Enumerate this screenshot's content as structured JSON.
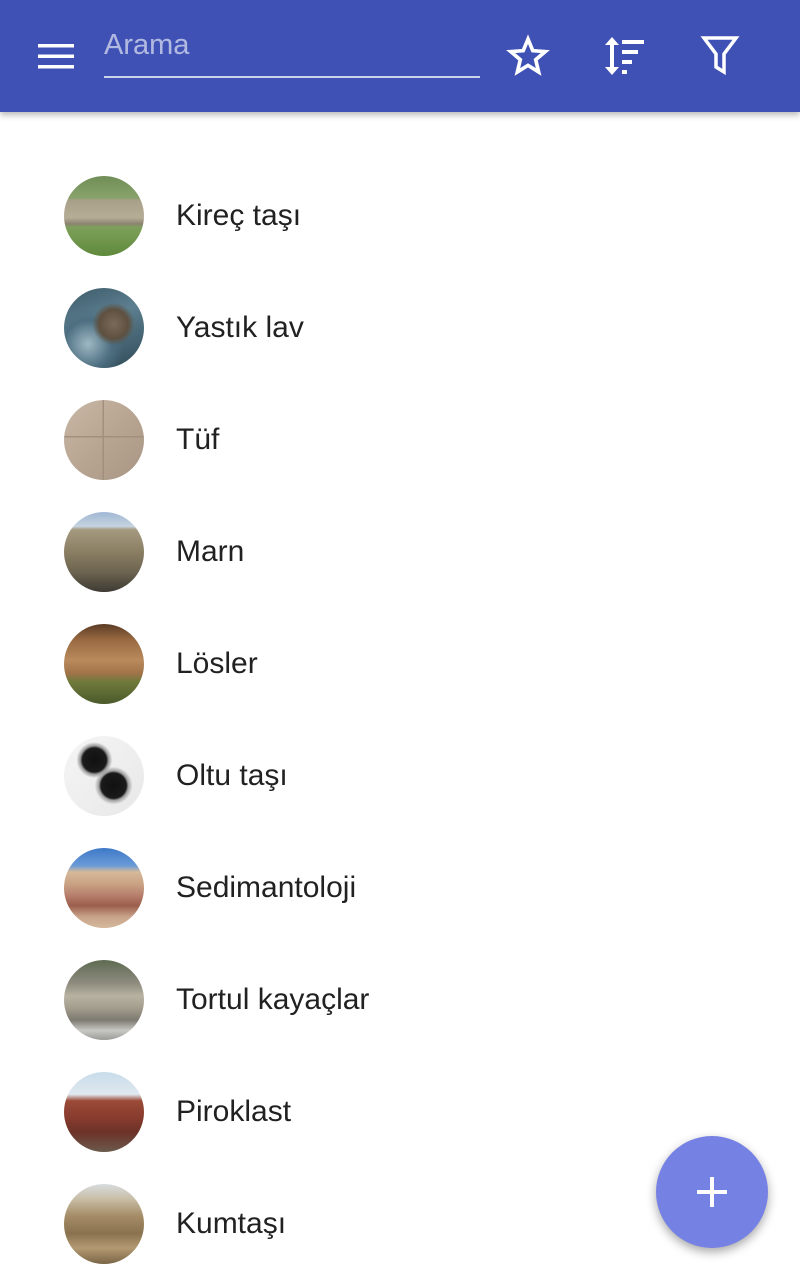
{
  "search": {
    "placeholder": "Arama",
    "value": ""
  },
  "icons": {
    "menu": "menu-icon",
    "favorite": "star-outline-icon",
    "sort": "sort-icon",
    "filter": "filter-icon",
    "add": "plus-icon"
  },
  "colors": {
    "appbar": "#3f51b5",
    "fab": "#7681e4",
    "text": "#212121"
  },
  "items": [
    {
      "label": "Kireç taşı",
      "thumb": "limestone-wall-photo"
    },
    {
      "label": "Yastık lav",
      "thumb": "pillow-lava-photo"
    },
    {
      "label": "Tüf",
      "thumb": "tuff-blocks-photo"
    },
    {
      "label": "Marn",
      "thumb": "marl-hills-photo"
    },
    {
      "label": "Lösler",
      "thumb": "loess-cliff-photo"
    },
    {
      "label": "Oltu taşı",
      "thumb": "oltu-stone-rings-photo"
    },
    {
      "label": "Sedimantoloji",
      "thumb": "sediment-layers-photo"
    },
    {
      "label": "Tortul kayaçlar",
      "thumb": "sedimentary-rock-cliff-photo"
    },
    {
      "label": "Piroklast",
      "thumb": "pyroclastic-cone-photo"
    },
    {
      "label": "Kumtaşı",
      "thumb": "sandstone-formation-photo"
    }
  ]
}
